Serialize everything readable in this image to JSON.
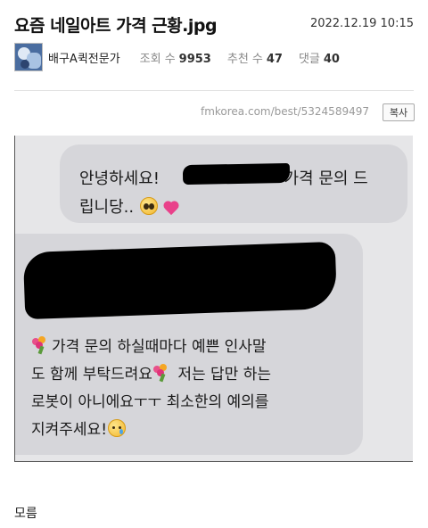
{
  "post": {
    "title": "요즘 네일아트 가격 근황.jpg",
    "date": "2022.12.19 10:15"
  },
  "author": {
    "nickname": "배구A퀵전문가",
    "avatar_icon": "avatar-image"
  },
  "stats": {
    "views_label": "조회 수",
    "views": "9953",
    "likes_label": "추천 수",
    "likes": "47",
    "comments_label": "댓글",
    "comments": "40"
  },
  "source": {
    "url": "fmkorea.com/best/5324589497",
    "copy_label": "복사"
  },
  "screenshot": {
    "bubble1": {
      "line1_start": "안녕하세요!",
      "line1_end": "가격 문의 드",
      "line2": "립니당..",
      "emojis": [
        "pleading-face-icon",
        "two-hearts-icon"
      ]
    },
    "bubble2": {
      "line1": "가격 문의 하실때마다 예쁜 인사말",
      "line2_start": "도 함께 부탁드려요",
      "line2_end": "저는 답만 하는",
      "line3": "로봇이 아니에요ㅜㅜ 최소한의 예의를",
      "line4": "지켜주세요!",
      "emojis": [
        "bouquet-icon",
        "bouquet-icon",
        "crying-face-icon"
      ]
    }
  },
  "footer": {
    "comment_text": "모름"
  },
  "colors": {
    "bubble": "#d6d6da",
    "screenshot_bg": "#e6e6e8",
    "heart": "#e9418a"
  }
}
